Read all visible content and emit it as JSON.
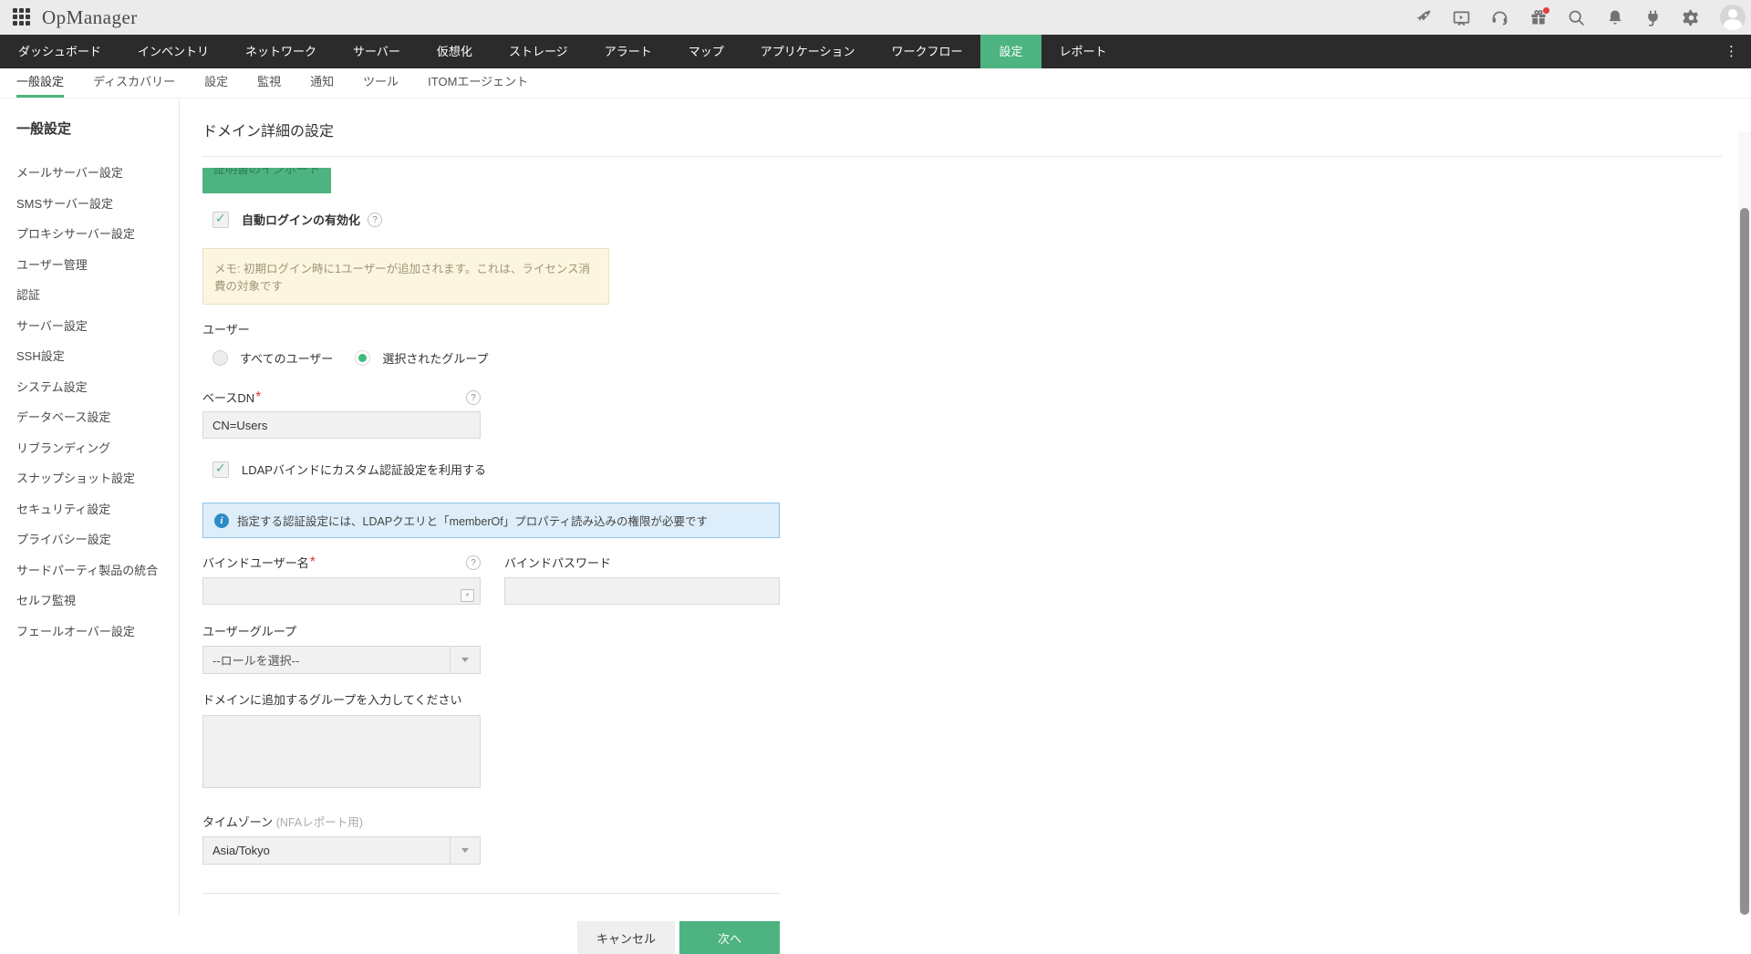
{
  "app": {
    "title": "OpManager"
  },
  "topbar": {
    "icons": [
      "rocket-icon",
      "presentation-icon",
      "headset-icon",
      "gift-icon",
      "search-icon",
      "bell-icon",
      "plug-icon",
      "gear-icon",
      "avatar"
    ]
  },
  "nav": {
    "overflow_icon": "⋮",
    "items": [
      {
        "label": "ダッシュボード",
        "active": false
      },
      {
        "label": "インベントリ",
        "active": false
      },
      {
        "label": "ネットワーク",
        "active": false
      },
      {
        "label": "サーバー",
        "active": false
      },
      {
        "label": "仮想化",
        "active": false
      },
      {
        "label": "ストレージ",
        "active": false
      },
      {
        "label": "アラート",
        "active": false
      },
      {
        "label": "マップ",
        "active": false
      },
      {
        "label": "アプリケーション",
        "active": false
      },
      {
        "label": "ワークフロー",
        "active": false
      },
      {
        "label": "設定",
        "active": true
      },
      {
        "label": "レポート",
        "active": false
      }
    ]
  },
  "subnav": {
    "items": [
      {
        "label": "一般設定",
        "active": true
      },
      {
        "label": "ディスカバリー",
        "active": false
      },
      {
        "label": "設定",
        "active": false
      },
      {
        "label": "監視",
        "active": false
      },
      {
        "label": "通知",
        "active": false
      },
      {
        "label": "ツール",
        "active": false
      },
      {
        "label": "ITOMエージェント",
        "active": false
      }
    ]
  },
  "sidebar": {
    "header": "一般設定",
    "items": [
      "メールサーバー設定",
      "SMSサーバー設定",
      "プロキシサーバー設定",
      "ユーザー管理",
      "認証",
      "サーバー設定",
      "SSH設定",
      "システム設定",
      "データベース設定",
      "リブランディング",
      "スナップショット設定",
      "セキュリティ設定",
      "プライバシー設定",
      "サードパーティ製品の統合",
      "セルフ監視",
      "フェールオーバー設定"
    ]
  },
  "main": {
    "title": "ドメイン詳細の設定",
    "import_button": "証明書のインポート",
    "auto_login": {
      "label": "自動ログインの有効化",
      "checked": true
    },
    "memo": "メモ: 初期ログイン時に1ユーザーが追加されます。これは、ライセンス消費の対象です",
    "user_section": {
      "label": "ユーザー",
      "options": [
        {
          "label": "すべてのユーザー",
          "selected": false
        },
        {
          "label": "選択されたグループ",
          "selected": true
        }
      ]
    },
    "base_dn": {
      "label": "ベースDN",
      "required": "*",
      "value": "CN=Users"
    },
    "ldap_custom": {
      "label": "LDAPバインドにカスタム認証設定を利用する",
      "checked": true
    },
    "info": "指定する認証設定には、LDAPクエリと「memberOf」プロパティ読み込みの権限が必要です",
    "bind_user": {
      "label": "バインドユーザー名",
      "required": "*",
      "value": ""
    },
    "bind_password": {
      "label": "バインドパスワード",
      "value": ""
    },
    "user_group": {
      "label": "ユーザーグループ",
      "value": "--ロールを選択--"
    },
    "group_input_label": "ドメインに追加するグループを入力してください",
    "timezone": {
      "label": "タイムゾーン",
      "hint": "(NFAレポート用)",
      "value": "Asia/Tokyo"
    },
    "buttons": {
      "cancel": "キャンセル",
      "next": "次へ"
    }
  },
  "colors": {
    "accent": "#4db380",
    "nav_bg": "#2b2b2b",
    "memo_bg": "#fcf6e1",
    "info_bg": "#ddeefa"
  }
}
